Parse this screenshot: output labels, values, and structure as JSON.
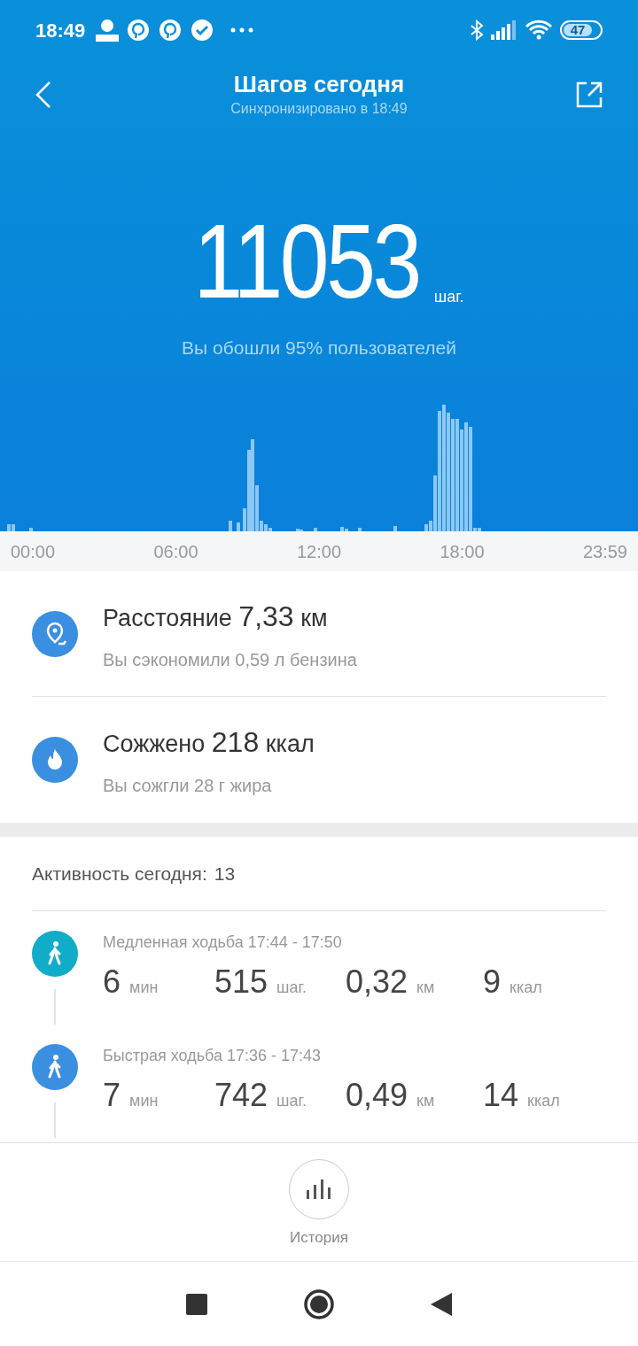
{
  "status_bar": {
    "time": "18:49",
    "battery": "47"
  },
  "header": {
    "title": "Шагов сегодня",
    "subtitle": "Синхронизировано в 18:49"
  },
  "summary": {
    "steps": "11053",
    "unit": "шаг.",
    "note": "Вы обошли 95% пользователей"
  },
  "chart_axis": [
    "00:00",
    "06:00",
    "12:00",
    "18:00",
    "23:59"
  ],
  "stats": [
    {
      "kind": "distance",
      "title": "Расстояние **7,33** км",
      "note": "Вы сэкономили 0,59 л бензина"
    },
    {
      "kind": "calories",
      "title": "Сожжено **218** ккал",
      "note": "Вы сожгли 28 г жира"
    }
  ],
  "activity": {
    "label": "Активность сегодня:",
    "count": "13",
    "items": [
      {
        "title": "Медленная ходьба 17:44 - 17:50",
        "color": "#10acc8",
        "values": [
          {
            "value": "6",
            "unit": "мин"
          },
          {
            "value": "515",
            "unit": "шаг."
          },
          {
            "value": "0,32",
            "unit": "км"
          },
          {
            "value": "9",
            "unit": "ккал"
          }
        ]
      },
      {
        "title": "Быстрая ходьба 17:36 - 17:43",
        "color": "#3b8fe0",
        "values": [
          {
            "value": "7",
            "unit": "мин"
          },
          {
            "value": "742",
            "unit": "шаг."
          },
          {
            "value": "0,49",
            "unit": "км"
          },
          {
            "value": "14",
            "unit": "ккал"
          }
        ]
      }
    ]
  },
  "history_button": {
    "label": "История"
  }
}
